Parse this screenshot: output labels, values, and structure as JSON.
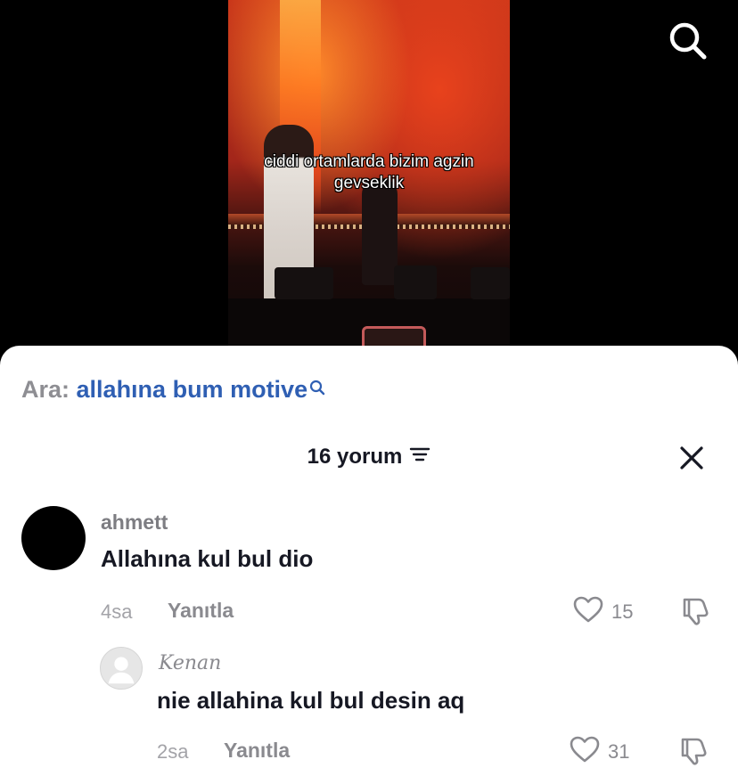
{
  "video": {
    "caption": "ciddi ortamlarda bizim agzin gevseklik"
  },
  "search": {
    "prefix": "Ara:",
    "query": "allahına bum motive"
  },
  "comments_header": {
    "title": "16 yorum"
  },
  "comments": [
    {
      "username": "ahmett",
      "text": "Allahına kul bul dio",
      "time": "4sa",
      "reply_label": "Yanıtla",
      "likes": "15"
    },
    {
      "username": "Kenan",
      "text": "nie allahina kul bul desin aq",
      "time": "2sa",
      "reply_label": "Yanıtla",
      "likes": "31"
    }
  ],
  "colors": {
    "search_query": "#2f5fb3",
    "text_primary": "#161823",
    "text_secondary": "#8a8a8f"
  }
}
